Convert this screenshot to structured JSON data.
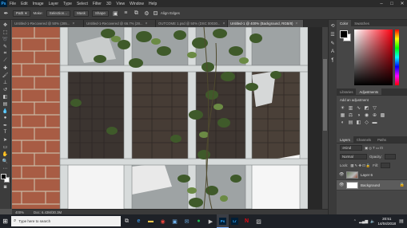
{
  "app": {
    "logo": "Ps",
    "menu": [
      "File",
      "Edit",
      "Image",
      "Layer",
      "Type",
      "Select",
      "Filter",
      "3D",
      "View",
      "Window",
      "Help"
    ],
    "window_controls": {
      "minimize": "–",
      "maximize": "□",
      "close": "✕"
    }
  },
  "options_bar": {
    "tool_mode": "Path",
    "make_label": "Make:",
    "selection_btn": "Selection...",
    "mask_btn": "Mask",
    "shape_btn": "Shape",
    "align_edges_label": "Align Edges"
  },
  "tabs": [
    {
      "label": "Untitled-1-Recovered @ 50% (285...",
      "active": false
    },
    {
      "label": "Untitled-1-Recovered @ 66.7% (28...",
      "active": false
    },
    {
      "label": "OUTCOME 1.psd @ 50% (DSC 00030...",
      "active": false
    },
    {
      "label": "Untitled-1 @ 400% (Background, RGB/8)",
      "active": true
    }
  ],
  "tab_close": "×",
  "status": {
    "zoom": "400%",
    "doc_info": "Doc: 6.43M/30.3M"
  },
  "color_panel": {
    "tabs": [
      "Color",
      "Swatches"
    ],
    "fg_color": "#000000",
    "bg_color": "#ffffff"
  },
  "adjustments_panel": {
    "tabs": [
      "Libraries",
      "Adjustments"
    ],
    "title": "Add an adjustment"
  },
  "layers_panel": {
    "tabs": [
      "Layers",
      "Channels",
      "Paths"
    ],
    "filter": "Kind",
    "blend_mode": "Normal",
    "opacity_label": "Opacity:",
    "lock_label": "Lock:",
    "fill_label": "Fill:",
    "layers": [
      {
        "name": "Layer 6",
        "visible": true,
        "selected": false,
        "thumb": "photo"
      },
      {
        "name": "Background",
        "visible": true,
        "selected": true,
        "thumb": "white",
        "locked": true
      }
    ]
  },
  "taskbar": {
    "search_placeholder": "Type here to search",
    "apps": [
      {
        "name": "task-view",
        "glyph": "⧉"
      },
      {
        "name": "edge",
        "glyph": "e",
        "color": "#3c8fd8"
      },
      {
        "name": "explorer",
        "glyph": "▬",
        "color": "#f0c64c"
      },
      {
        "name": "chrome",
        "glyph": "◉",
        "color": "#e8453c"
      },
      {
        "name": "store",
        "glyph": "▣",
        "color": "#6fb0ea"
      },
      {
        "name": "mail",
        "glyph": "✉",
        "color": "#6fb0ea"
      },
      {
        "name": "spotify",
        "glyph": "●",
        "color": "#1db954"
      },
      {
        "name": "media",
        "glyph": "▶",
        "color": "#cccccc"
      },
      {
        "name": "photoshop",
        "glyph": "Ps",
        "color": "#31a8ff",
        "bg": "#001e36",
        "active": true
      },
      {
        "name": "lightroom",
        "glyph": "Lr",
        "color": "#31a8ff",
        "bg": "#001e36"
      },
      {
        "name": "netflix",
        "glyph": "N",
        "color": "#e50914"
      },
      {
        "name": "photos",
        "glyph": "▨",
        "color": "#cccccc"
      }
    ],
    "time": "20:51",
    "date": "14/04/2018"
  }
}
